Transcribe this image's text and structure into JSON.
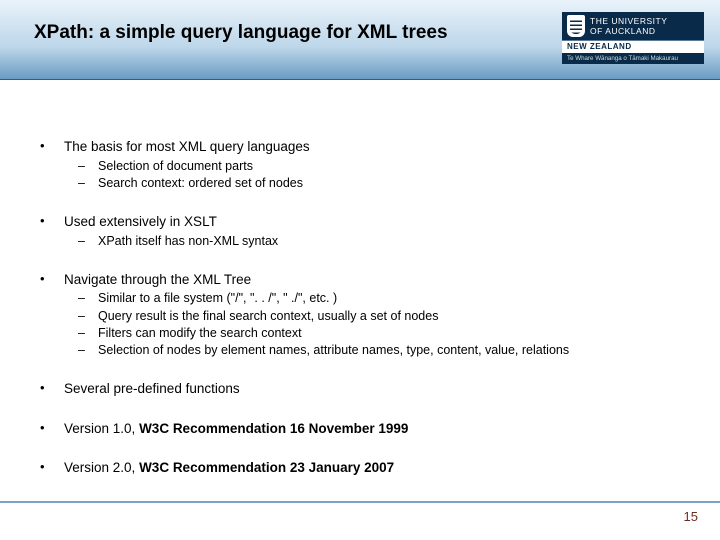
{
  "header": {
    "title": "XPath: a simple query language for XML trees",
    "logo": {
      "main": "THE UNIVERSITY\nOF AUCKLAND",
      "mid": "NEW ZEALAND",
      "bot": "Te Whare Wānanga o Tāmaki Makaurau"
    }
  },
  "bullets": [
    {
      "text": "The basis for most XML query languages",
      "subs": [
        "Selection of document parts",
        "Search context: ordered set of nodes"
      ]
    },
    {
      "text": "Used extensively in XSLT",
      "subs": [
        "XPath itself has non-XML syntax"
      ]
    },
    {
      "text": "Navigate through the XML Tree",
      "subs": [
        "Similar to a file system (\"/\", \". . /\", \" ./\", etc. )",
        "Query result is the final search context, usually a set of nodes",
        "Filters can modify the search context",
        "Selection of nodes by element names, attribute names, type, content, value, relations"
      ]
    },
    {
      "text": " Several pre-defined functions",
      "subs": []
    },
    {
      "html": "Version 1.0, <b>W3C Recommendation 16 November 1999</b>",
      "subs": []
    },
    {
      "html": "Version 2.0, <b>W3C Recommendation 23 January 2007</b>",
      "subs": []
    }
  ],
  "footer": {
    "page": "15"
  }
}
